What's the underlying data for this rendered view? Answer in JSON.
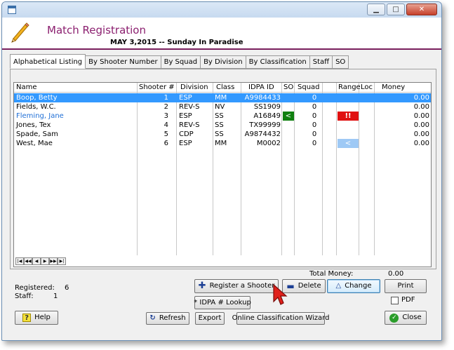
{
  "window": {
    "title": "",
    "controls": {
      "minimize": "▁",
      "maximize": "□",
      "close": "✕"
    }
  },
  "header": {
    "app_title": "Match Registration",
    "match_date": "MAY  3,2015 -- Sunday In Paradise"
  },
  "tabs": [
    {
      "label": "Alphabetical Listing",
      "active": true
    },
    {
      "label": "By Shooter Number",
      "active": false
    },
    {
      "label": "By Squad",
      "active": false
    },
    {
      "label": "By Division",
      "active": false
    },
    {
      "label": "By Classification",
      "active": false
    },
    {
      "label": "Staff",
      "active": false
    },
    {
      "label": "SO",
      "active": false
    }
  ],
  "table": {
    "columns": [
      "Name",
      "Shooter #",
      "Division",
      "Class",
      "IDPA ID",
      "SO",
      "Squad",
      "Range",
      "Loc",
      "Money"
    ],
    "rows": [
      {
        "name": "Boop, Betty",
        "shooter": "1",
        "division": "ESP",
        "class": "MM",
        "idpa": "A9984433",
        "so": "",
        "squad": "0",
        "range": "",
        "loc": "",
        "money": "0.00",
        "selected": true
      },
      {
        "name": "Fields, W.C.",
        "shooter": "2",
        "division": "REV-S",
        "class": "NV",
        "idpa": "SS1909",
        "so": "",
        "squad": "0",
        "range": "",
        "loc": "",
        "money": "0.00"
      },
      {
        "name": "Fleming, Jane",
        "shooter": "3",
        "division": "ESP",
        "class": "SS",
        "idpa": "A16849",
        "so": "<",
        "squad": "0",
        "range": "!!",
        "loc": "",
        "money": "0.00",
        "blue_name": true
      },
      {
        "name": "Jones, Tex",
        "shooter": "4",
        "division": "REV-S",
        "class": "SS",
        "idpa": "TX99999",
        "so": "",
        "squad": "0",
        "range": "",
        "loc": "",
        "money": "0.00"
      },
      {
        "name": "Spade, Sam",
        "shooter": "5",
        "division": "CDP",
        "class": "SS",
        "idpa": "A9874432",
        "so": "",
        "squad": "0",
        "range": "",
        "loc": "",
        "money": "0.00"
      },
      {
        "name": "West, Mae",
        "shooter": "6",
        "division": "ESP",
        "class": "MM",
        "idpa": "M0002",
        "so": "",
        "squad": "0",
        "range": "<",
        "loc": "",
        "money": "0.00"
      }
    ],
    "nav": [
      "|◀",
      "◀◀",
      "◀",
      "▶",
      "▶▶",
      "▶|"
    ]
  },
  "totals": {
    "label": "Total Money:",
    "value": "0.00"
  },
  "stats": {
    "registered_label": "Registered:",
    "registered_value": "6",
    "staff_label": "Staff:",
    "staff_value": "1"
  },
  "buttons": {
    "register": "Register a Shooter",
    "delete": "Delete",
    "change": "Change",
    "print": "Print",
    "idpa_lookup": "* IDPA # Lookup",
    "pdf": "PDF",
    "help": "Help",
    "refresh": "Refresh",
    "export": "Export",
    "wizard": "Online Classification Wizard",
    "close": "Close"
  },
  "colors": {
    "title": "#8b1f6f",
    "selection": "#3399ff",
    "so_green": "#108010",
    "range_red": "#e01010",
    "range_blue": "#9ec9f5",
    "link_blue": "#1f6fd6"
  }
}
